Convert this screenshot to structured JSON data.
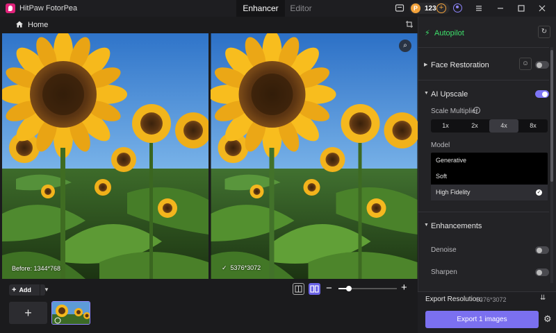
{
  "app": {
    "name": "HitPaw FotorPea"
  },
  "tabs": [
    {
      "label": "Enhancer"
    },
    {
      "label": "Editor"
    }
  ],
  "header": {
    "credits": "123"
  },
  "breadcrumb": {
    "home_label": "Home"
  },
  "preview": {
    "before_label": "Before: 1344*768",
    "after_label": "5376*3072"
  },
  "toolbar": {
    "add_label": "Add",
    "zoom_level": 0.18
  },
  "panel": {
    "autopilot_label": "Autopilot",
    "face_restoration": {
      "label": "Face Restoration",
      "enabled": false
    },
    "ai_upscale": {
      "label": "AI Upscale",
      "enabled": true,
      "scale_label": "Scale Multiplier",
      "scales": [
        "1x",
        "2x",
        "4x",
        "8x"
      ],
      "selected_scale": "4x",
      "model_label": "Model",
      "models": [
        "Generative",
        "Soft",
        "High Fidelity"
      ],
      "selected_model": "High Fidelity"
    },
    "enhancements": {
      "label": "Enhancements",
      "items": [
        {
          "label": "Denoise",
          "enabled": false
        },
        {
          "label": "Sharpen",
          "enabled": false
        }
      ]
    },
    "export": {
      "resolution_label": "Export Resolution:",
      "resolution_value": "5376*3072",
      "button_label": "Export 1 images"
    }
  },
  "colors": {
    "accent": "#7b70f0",
    "autopilot": "#3ee06b",
    "credits": "#f2a23b"
  }
}
